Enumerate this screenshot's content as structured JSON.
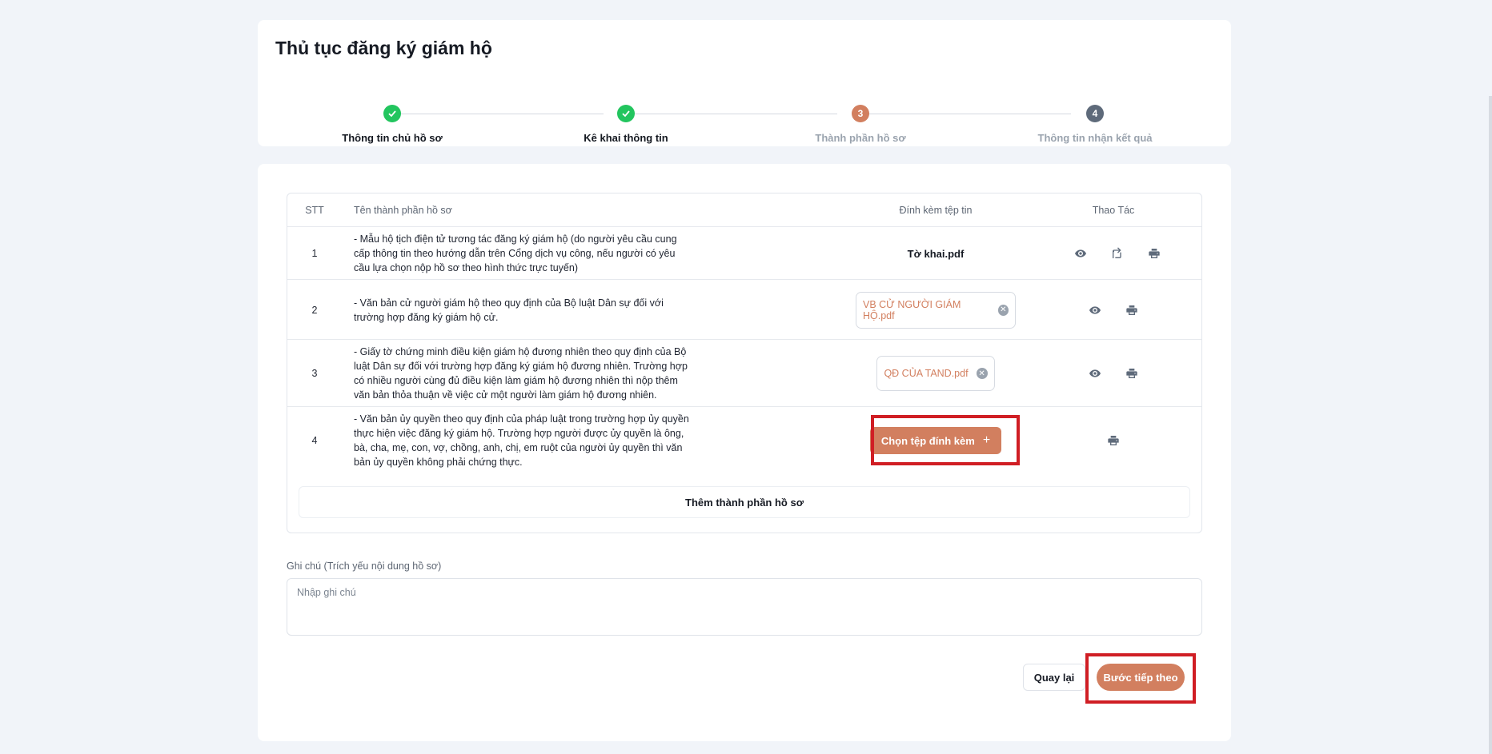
{
  "page": {
    "title": "Thủ tục đăng ký giám hộ"
  },
  "stepper": {
    "steps": [
      {
        "number": "1",
        "label": "Thông tin chủ hồ sơ",
        "status": "done"
      },
      {
        "number": "2",
        "label": "Kê khai thông tin",
        "status": "done"
      },
      {
        "number": "3",
        "label": "Thành phần hồ sơ",
        "status": "current"
      },
      {
        "number": "4",
        "label": "Thông tin nhận kết quả",
        "status": "todo"
      }
    ]
  },
  "table": {
    "headers": {
      "stt": "STT",
      "name": "Tên thành phần hồ sơ",
      "file": "Đính kèm tệp tin",
      "actions": "Thao Tác"
    },
    "rows": [
      {
        "stt": "1",
        "name": "- Mẫu hộ tịch điện tử tương tác đăng ký giám hộ (do người yêu cầu cung cấp thông tin theo hướng dẫn trên Cổng dịch vụ công, nếu người có yêu cầu lựa chọn nộp hồ sơ theo hình thức trực tuyến)",
        "file": "Tờ khai.pdf",
        "actions": [
          "eye-icon",
          "sign-icon",
          "printer-icon"
        ]
      },
      {
        "stt": "2",
        "name": "- Văn bản cử người giám hộ theo quy định của Bộ luật Dân sự đối với trường hợp đăng ký giám hộ cử.",
        "file": "VB CỬ NGƯỜI GIÁM HỘ.pdf",
        "actions": [
          "eye-icon",
          "printer-icon"
        ]
      },
      {
        "stt": "3",
        "name": "- Giấy tờ chứng minh điều kiện giám hộ đương nhiên theo quy định của Bộ luật Dân sự đối với trường hợp đăng ký giám hộ đương nhiên. Trường hợp có nhiều người cùng đủ điều kiện làm giám hộ đương nhiên thì nộp thêm văn bản thỏa thuận về việc cử một người làm giám hộ đương nhiên.",
        "file": "QĐ CỦA TAND.pdf",
        "actions": [
          "eye-icon",
          "printer-icon"
        ]
      },
      {
        "stt": "4",
        "name": "- Văn bản ủy quyền theo quy định của pháp luật trong trường hợp ủy quyền thực hiện việc đăng ký giám hộ. Trường hợp người được ủy quyền là ông, bà, cha, mẹ, con, vợ, chồng, anh, chị, em ruột của người ủy quyền thì văn bản ủy quyền không phải chứng thực.",
        "file_button": "Chọn tệp đính kèm",
        "actions": [
          "printer-icon"
        ]
      }
    ],
    "add_row_label": "Thêm thành phần hồ sơ"
  },
  "note": {
    "label": "Ghi chú (Trích yếu nội dung hồ sơ)",
    "placeholder": "Nhập ghi chú",
    "value": ""
  },
  "footer": {
    "back_label": "Quay lại",
    "next_label": "Bước tiếp theo"
  },
  "colors": {
    "accent": "#d27f5f",
    "done": "#22c55e",
    "todo": "#5e6a7a",
    "highlight": "#d01e24"
  }
}
